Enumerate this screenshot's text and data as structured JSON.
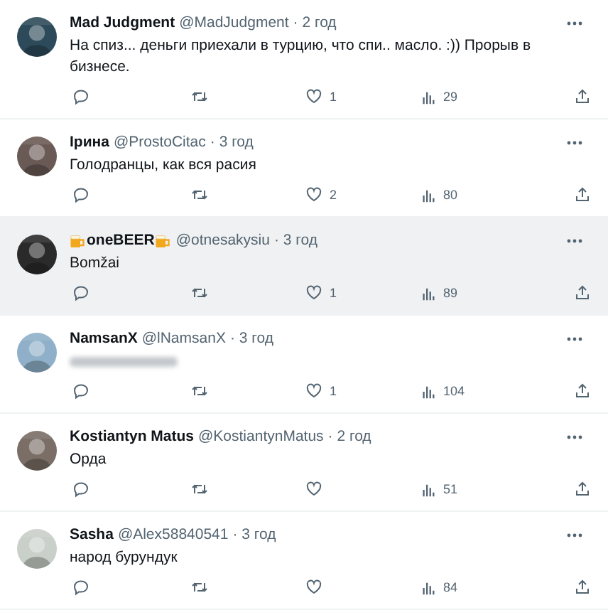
{
  "tweets": [
    {
      "name": "Mad Judgment",
      "name_badges": false,
      "handle": "@MadJudgment",
      "time": "· 2 год",
      "text": "На спиз... деньги приехали в турцию, что спи.. масло. :)) Прорыв в бизнесе.",
      "text_blurred": false,
      "highlighted": false,
      "likes": "1",
      "views": "29"
    },
    {
      "name": "Ірина",
      "name_badges": false,
      "handle": "@ProstoCitac",
      "time": "· 3 год",
      "text": "Голодранцы, как вся расия",
      "text_blurred": false,
      "highlighted": false,
      "likes": "2",
      "views": "80"
    },
    {
      "name": "oneBEER",
      "name_badges": true,
      "handle": "@otnesakysiu",
      "time": "· 3 год",
      "text": "Bomžai",
      "text_blurred": false,
      "highlighted": true,
      "likes": "1",
      "views": "89"
    },
    {
      "name": "NamsanX",
      "name_badges": false,
      "handle": "@lNamsanX",
      "time": "· 3 год",
      "text_blurred": true,
      "highlighted": false,
      "likes": "1",
      "views": "104"
    },
    {
      "name": "Kostiantyn Matus",
      "name_badges": false,
      "handle": "@KostiantynMatus",
      "time": "· 2 год",
      "text": "Орда",
      "text_blurred": false,
      "highlighted": false,
      "views": "51"
    },
    {
      "name": "Sasha",
      "name_badges": false,
      "handle": "@Alex58840541",
      "time": "· 3 год",
      "text": "народ бурундук",
      "text_blurred": false,
      "highlighted": false,
      "views": "84"
    }
  ]
}
